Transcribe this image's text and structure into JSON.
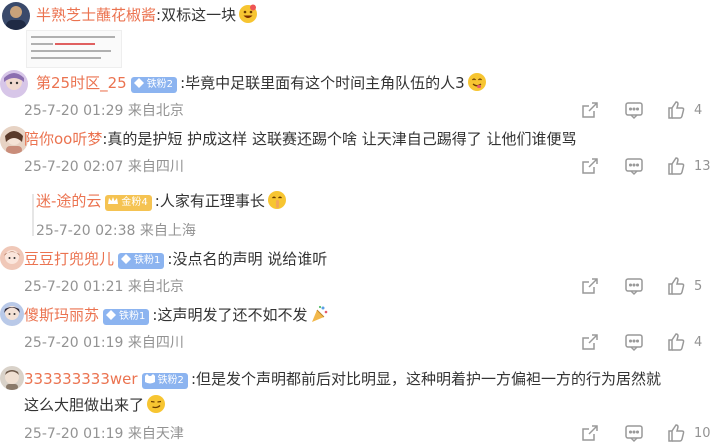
{
  "comments": [
    {
      "username": "半熟芝士蘸花椒酱",
      "text": ":双标这一块",
      "emoji": "grinning-face-icon"
    },
    {
      "username": "第25时区_25",
      "badge": "铁粉2",
      "text": ":毕竟中足联里面有这个时间主角队伍的人3",
      "emoji": "yum-face-icon",
      "meta": "25-7-20 01:29 来自北京",
      "likes": "4"
    },
    {
      "username": "陪你oo听梦",
      "text": ":真的是护短 护成这样 这联赛还踢个啥   让天津自己踢得了 让他们谁便骂",
      "meta": "25-7-20 02:07 来自四川",
      "likes": "13"
    },
    {
      "username": "迷-途的云",
      "badge": "金粉4",
      "text": ":人家有正理事长",
      "emoji": "shush-face-icon",
      "meta": "25-7-20 02:38 来自上海"
    },
    {
      "username": "豆豆打兜兜儿",
      "badge": "铁粉1",
      "text": ":没点名的声明 说给谁听",
      "meta": "25-7-20 01:21 来自北京",
      "likes": "5"
    },
    {
      "username": "傻斯玛丽苏",
      "badge": "铁粉1",
      "text": ":这声明发了还不如不发",
      "emoji": "confetti-popper-icon",
      "meta": "25-7-20 01:19 来自四川",
      "likes": "4"
    },
    {
      "username": "333333333wer",
      "badge": "铁粉2",
      "text": ":但是发个声明都前后对比明显，这种明着护一方偏袒一方的行为居然就",
      "text2": "这么大胆做出来了",
      "emoji": "smirk-face-icon",
      "meta": "25-7-20 01:19 来自天津",
      "likes": "10"
    }
  ],
  "colors": {
    "username": "#eb7350",
    "meta": "#939393",
    "badge_fan": "#8cb4f0",
    "badge_gold": "#f5c352"
  }
}
